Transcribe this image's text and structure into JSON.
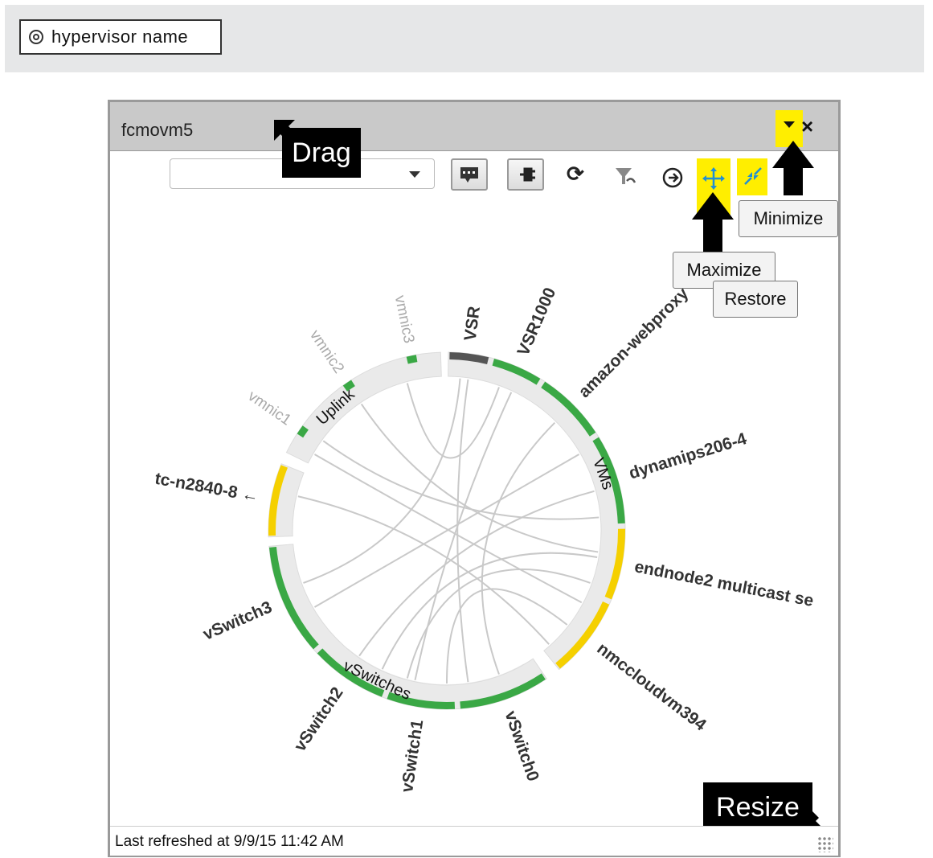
{
  "toolbar": {
    "filter_button_label": "hypervisor name"
  },
  "panel": {
    "title": "fcmovm5",
    "status": "Last refreshed at 9/9/15 11:42 AM",
    "combo_value": ""
  },
  "annotations": {
    "drag": "Drag",
    "resize": "Resize",
    "minimize": "Minimize",
    "maximize": "Maximize",
    "restore": "Restore"
  },
  "chart": {
    "groups": [
      {
        "name": "VMs",
        "members": [
          {
            "label": "VSR",
            "status": "dark"
          },
          {
            "label": "VSR1000",
            "status": "green"
          },
          {
            "label": "amazon-webproxy",
            "status": "green"
          },
          {
            "label": "dynamips206-4",
            "status": "green"
          },
          {
            "label": "endnode2 multicast se",
            "status": "yellow"
          },
          {
            "label": "nmccloudvm394",
            "status": "yellow"
          }
        ]
      },
      {
        "name": "vSwitches",
        "members": [
          {
            "label": "vSwitch0",
            "status": "green"
          },
          {
            "label": "vSwitch1",
            "status": "green"
          },
          {
            "label": "vSwitch2",
            "status": "green"
          },
          {
            "label": "vSwitch3",
            "status": "green"
          }
        ]
      },
      {
        "name": "",
        "members": [
          {
            "label": "tc-n2840-8 ←",
            "status": "yellow"
          }
        ]
      },
      {
        "name": "Uplink",
        "members": [
          {
            "label": "vmnic1",
            "status": "green"
          },
          {
            "label": "vmnic2",
            "status": "green"
          },
          {
            "label": "vmnic3",
            "status": "green"
          }
        ]
      }
    ],
    "colors": {
      "green": "#3aa845",
      "yellow": "#f5d000",
      "dark": "#555555",
      "track": "#eaeaea",
      "chord": "#c9c9c9",
      "highlight": "#ffee00"
    }
  }
}
